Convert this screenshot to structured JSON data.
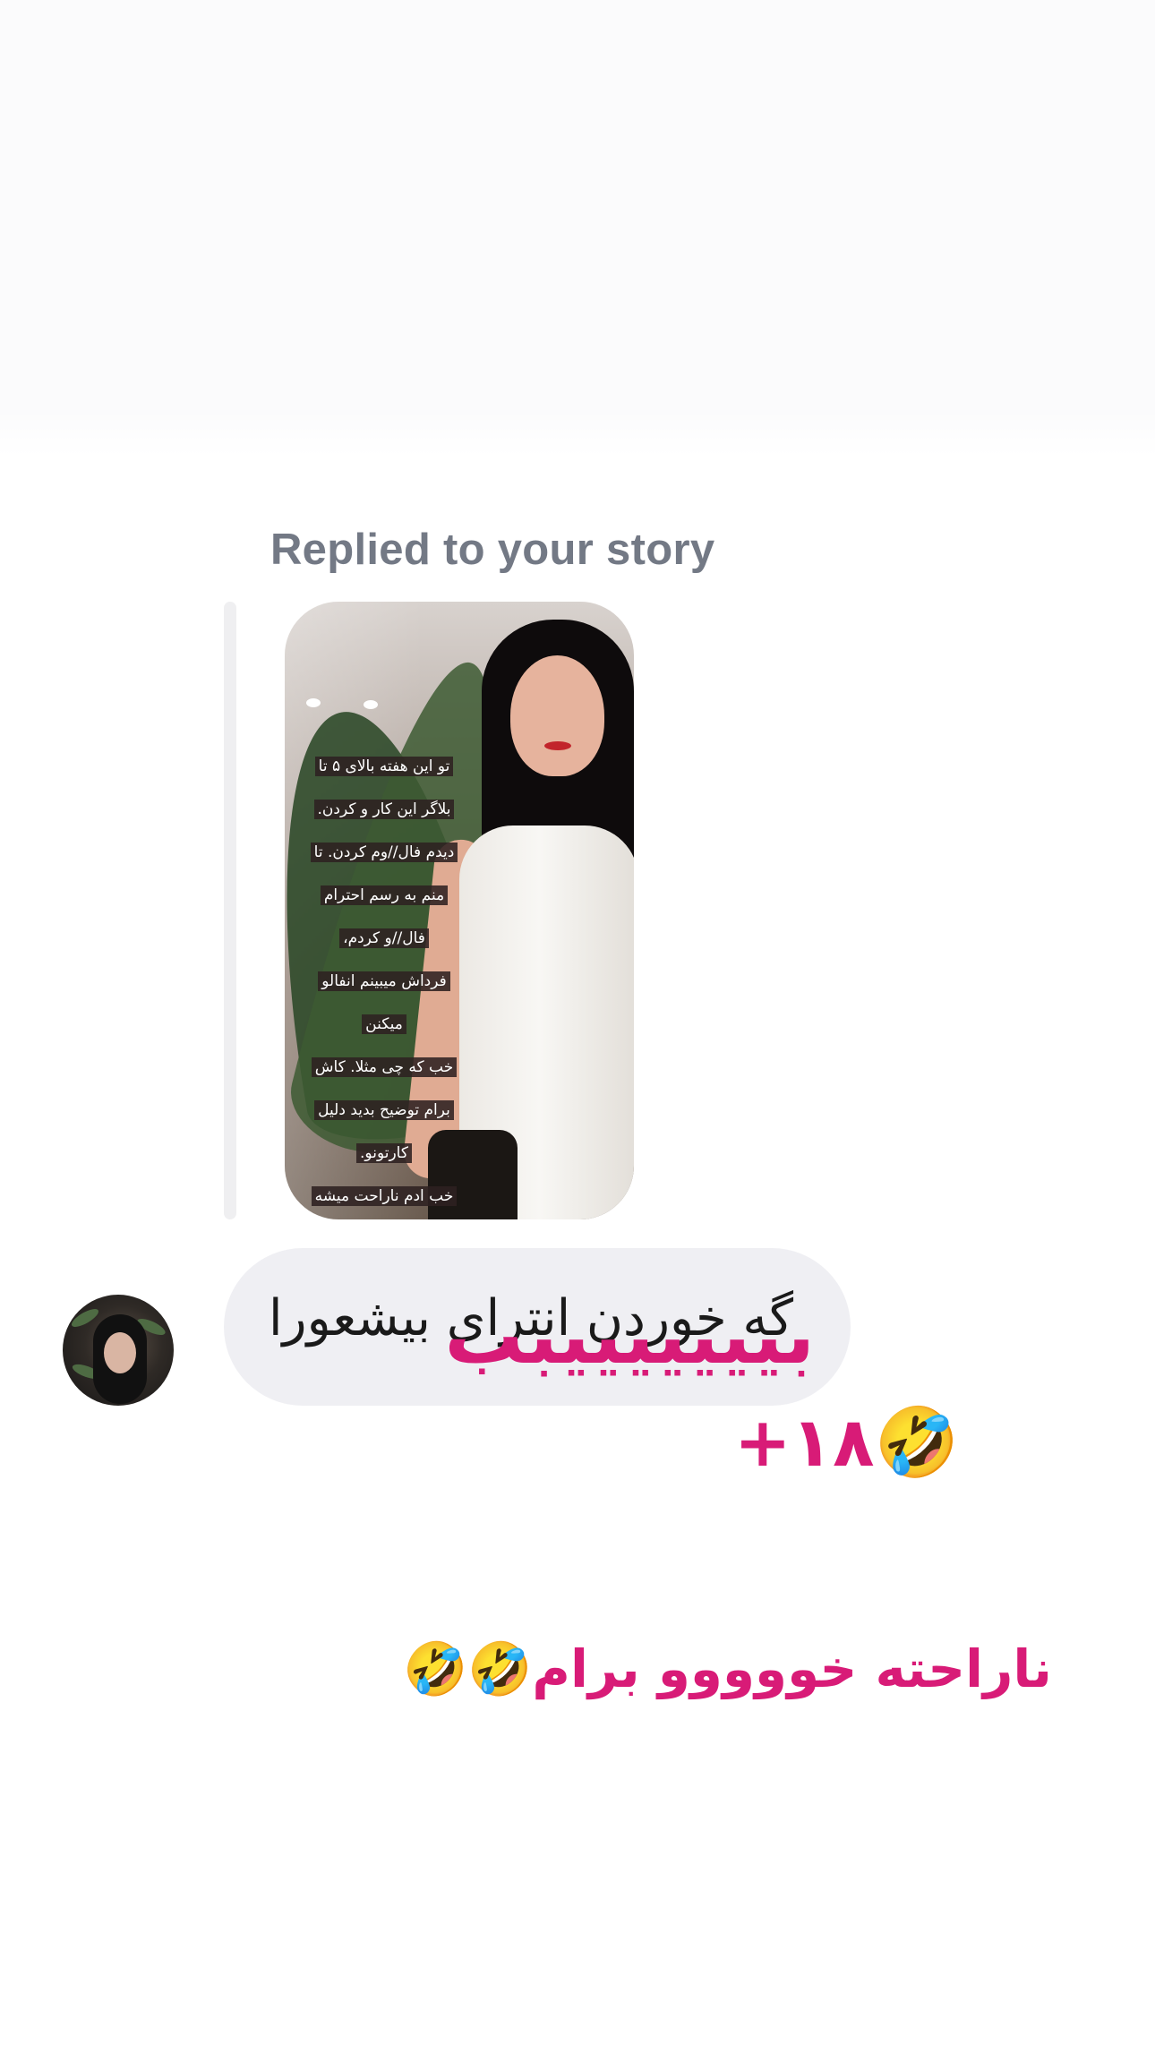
{
  "story_reply": {
    "label": "Replied to your story",
    "story_text_lines": [
      "تو این هفته بالای ۵ تا",
      "بلاگر این کار و کردن.",
      "دیدم فال//وم کردن. تا",
      "منم به رسم احترام",
      "فال//و کردم،",
      "فرداش میبینم انفالو",
      "میکنن",
      "خب که چی مثلا. کاش",
      "برام توضیح بدید دلیل",
      "کارتونو.",
      "خب ادم ناراحت میشه"
    ]
  },
  "message": {
    "text": "گه خوردن انترای بیشعورا"
  },
  "overlays": {
    "line1": "بیییییییبب",
    "line2": "+۱۸🤣",
    "line3": "ناراحته خووووو برام🤣🤣"
  },
  "colors": {
    "overlay_text": "#d81b77",
    "bubble_bg": "#efeff3",
    "label": "#737985"
  }
}
